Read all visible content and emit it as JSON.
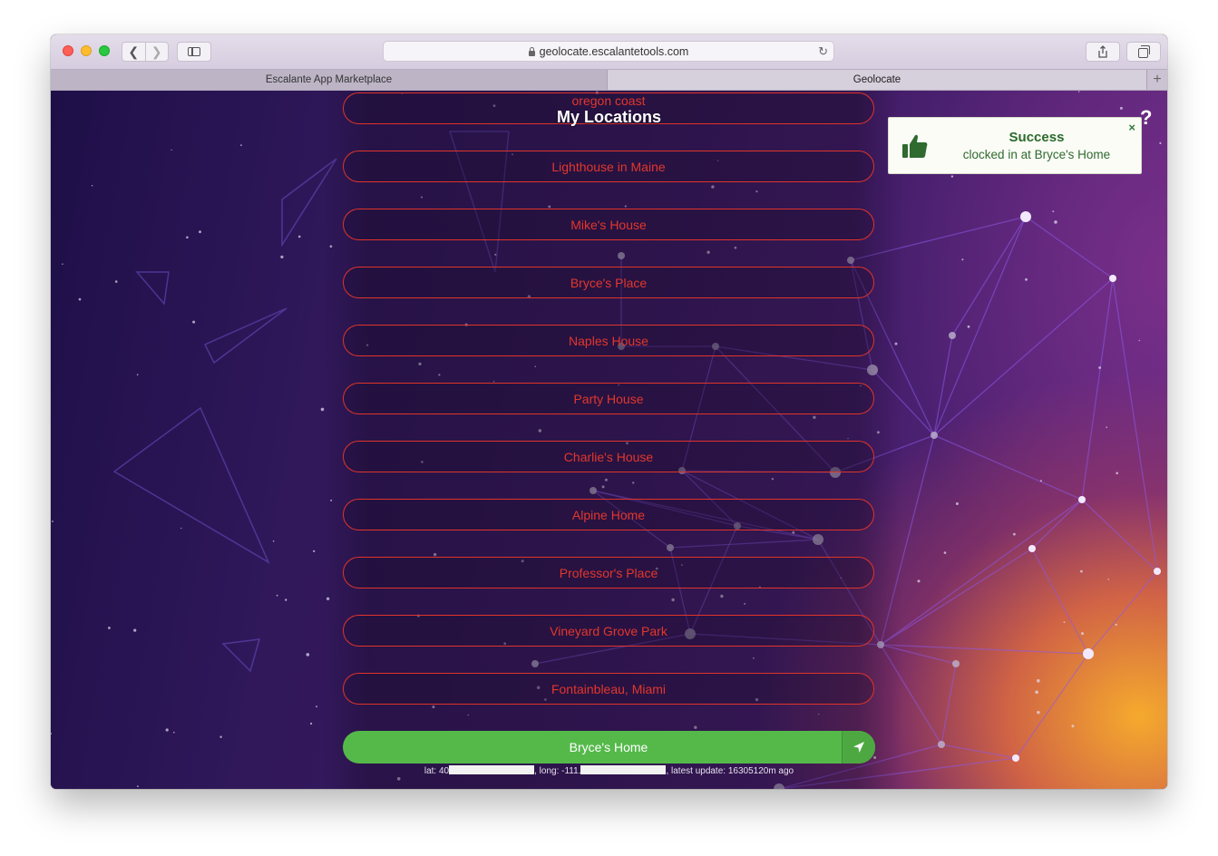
{
  "browser": {
    "url": "geolocate.escalantetools.com",
    "tabs": [
      {
        "label": "Escalante App Marketplace",
        "active": false
      },
      {
        "label": "Geolocate",
        "active": true
      }
    ],
    "new_tab_label": "+"
  },
  "page": {
    "title": "My Locations",
    "help_label": "?",
    "locations": [
      "oregon coast",
      "Lighthouse in Maine",
      "Mike's House",
      "Bryce's Place",
      "Naples House",
      "Party House",
      "Charlie's House",
      "Alpine Home",
      "Professor's Place",
      "Vineyard Grove Park",
      "Fontainbleau, Miami"
    ],
    "current_location": {
      "label": "Bryce's Home",
      "lat_prefix": "lat: 40",
      "long_prefix": ", long: -111.",
      "update_text": ", latest update: 16305120m ago"
    },
    "toast": {
      "title": "Success",
      "message": "clocked in at Bryce's Home",
      "close_label": "×"
    }
  },
  "colors": {
    "location_border": "#e0342a",
    "current_green": "#55b94a",
    "toast_text": "#2b6a2b"
  }
}
